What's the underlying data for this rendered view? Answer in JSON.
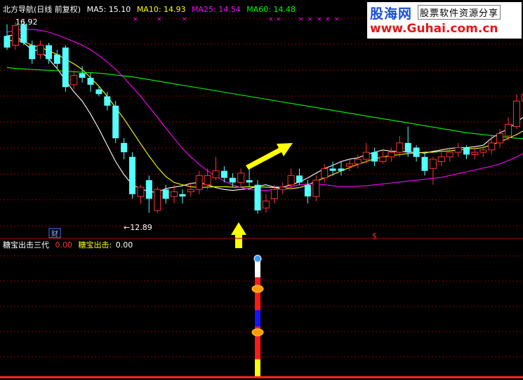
{
  "header": {
    "title": "北方导航(日线 前复权)",
    "ma5": "MA5: 15.10",
    "ma10": "MA10: 14.93",
    "ma25": "MA25: 14.54",
    "ma60": "MA60: 14.48"
  },
  "lower_header": {
    "name": "糖宝出击三代",
    "name_value": "0.00",
    "line_label": "糖宝出击:",
    "line_value": "0.00"
  },
  "markers": {
    "high_label": "16.92",
    "low_label": "←12.89",
    "cai_badge": "财",
    "dollar_mark": "$",
    "x_marks": [
      "×",
      "×",
      "×",
      "×",
      "×",
      "×",
      "×",
      "×",
      "×",
      "×"
    ]
  },
  "watermark": {
    "brand": "股海网",
    "tagline": "股票软件资源分享",
    "url": "www.Guhai.com.cn"
  },
  "colors": {
    "up": "#ff3232",
    "down": "#54ffff",
    "ma5": "#ffffff",
    "ma10": "#ffff00",
    "ma25": "#ff00ff",
    "ma60": "#00ff00",
    "grid": "#8b0000",
    "arrow": "#ffff00"
  },
  "chart_data": {
    "type": "candlestick",
    "ylim": [
      12.5,
      17.2
    ],
    "series": [
      {
        "name": "MA5",
        "values": [
          16.7,
          16.72,
          16.55,
          16.4,
          16.38,
          16.2,
          16.0,
          15.75,
          15.5,
          15.3,
          15.02,
          14.7,
          14.35,
          14.0,
          13.72,
          13.5,
          13.42,
          13.35,
          13.34,
          13.42,
          13.45,
          13.48,
          13.53,
          13.55,
          13.5,
          13.44,
          13.4,
          13.38,
          13.4,
          13.42,
          13.47,
          13.5,
          13.45,
          13.45,
          13.5,
          13.56,
          13.65,
          13.75,
          13.85,
          13.92,
          14.0,
          14.05,
          14.08,
          14.15,
          14.2,
          14.25,
          14.22,
          14.22,
          14.2,
          14.2,
          14.18,
          14.22,
          14.25,
          14.28,
          14.3,
          14.3,
          14.32,
          14.35,
          14.5,
          14.62,
          14.7,
          14.85,
          14.98,
          15.05,
          15.1
        ]
      },
      {
        "name": "MA10",
        "values": [
          16.6,
          16.6,
          16.58,
          16.5,
          16.45,
          16.38,
          16.3,
          16.2,
          16.1,
          15.98,
          15.8,
          15.62,
          15.4,
          15.16,
          14.92,
          14.65,
          14.38,
          14.12,
          13.88,
          13.68,
          13.55,
          13.5,
          13.46,
          13.44,
          13.45,
          13.46,
          13.46,
          13.45,
          13.45,
          13.46,
          13.46,
          13.45,
          13.44,
          13.42,
          13.42,
          13.44,
          13.5,
          13.58,
          13.65,
          13.72,
          13.8,
          13.87,
          13.94,
          14.0,
          14.06,
          14.1,
          14.13,
          14.15,
          14.17,
          14.18,
          14.2,
          14.2,
          14.22,
          14.23,
          14.25,
          14.27,
          14.28,
          14.3,
          14.36,
          14.42,
          14.5,
          14.58,
          14.68,
          14.8,
          14.93
        ]
      },
      {
        "name": "MA25",
        "values": [
          16.78,
          16.82,
          16.84,
          16.84,
          16.82,
          16.78,
          16.72,
          16.65,
          16.58,
          16.5,
          16.4,
          16.28,
          16.14,
          15.98,
          15.8,
          15.6,
          15.4,
          15.18,
          14.95,
          14.72,
          14.5,
          14.28,
          14.1,
          13.94,
          13.8,
          13.68,
          13.58,
          13.5,
          13.44,
          13.4,
          13.38,
          13.38,
          13.4,
          13.42,
          13.46,
          13.5,
          13.52,
          13.52,
          13.5,
          13.48,
          13.46,
          13.46,
          13.47,
          13.48,
          13.5,
          13.52,
          13.54,
          13.56,
          13.58,
          13.6,
          13.62,
          13.64,
          13.66,
          13.7,
          13.74,
          13.78,
          13.82,
          13.86,
          13.9,
          13.95,
          14.02,
          14.1,
          14.2,
          14.35,
          14.54
        ]
      },
      {
        "name": "MA60",
        "values": [
          16.02,
          16.0,
          15.99,
          15.98,
          15.97,
          15.96,
          15.95,
          15.94,
          15.93,
          15.92,
          15.91,
          15.9,
          15.88,
          15.86,
          15.84,
          15.82,
          15.79,
          15.76,
          15.73,
          15.7,
          15.67,
          15.64,
          15.61,
          15.58,
          15.55,
          15.52,
          15.49,
          15.46,
          15.43,
          15.4,
          15.37,
          15.34,
          15.31,
          15.28,
          15.25,
          15.22,
          15.19,
          15.16,
          15.13,
          15.1,
          15.07,
          15.04,
          15.01,
          14.98,
          14.95,
          14.92,
          14.89,
          14.86,
          14.83,
          14.8,
          14.77,
          14.74,
          14.71,
          14.68,
          14.65,
          14.62,
          14.6,
          14.58,
          14.56,
          14.54,
          14.52,
          14.5,
          14.49,
          14.48,
          14.48
        ]
      }
    ],
    "candles": [
      [
        16.7,
        16.45,
        16.95,
        16.4
      ],
      [
        16.5,
        16.92,
        16.99,
        16.4
      ],
      [
        16.95,
        16.55,
        17.05,
        16.5
      ],
      [
        16.5,
        16.2,
        16.6,
        16.1
      ],
      [
        16.3,
        16.5,
        16.6,
        16.2
      ],
      [
        16.5,
        16.2,
        16.55,
        16.1
      ],
      [
        16.3,
        16.1,
        16.4,
        16.0
      ],
      [
        16.45,
        15.6,
        16.5,
        15.5
      ],
      [
        15.65,
        15.85,
        15.95,
        15.55
      ],
      [
        15.9,
        15.8,
        16.05,
        15.7
      ],
      [
        15.8,
        15.65,
        15.9,
        15.5
      ],
      [
        15.55,
        15.45,
        15.6,
        15.4
      ],
      [
        15.4,
        15.2,
        15.5,
        15.1
      ],
      [
        15.2,
        14.5,
        15.3,
        14.4
      ],
      [
        14.4,
        14.2,
        14.5,
        14.05
      ],
      [
        14.1,
        13.3,
        14.2,
        13.2
      ],
      [
        13.25,
        13.45,
        13.5,
        13.1
      ],
      [
        13.6,
        13.2,
        13.7,
        12.9
      ],
      [
        12.95,
        13.4,
        13.45,
        12.89
      ],
      [
        13.4,
        13.2,
        13.5,
        13.1
      ],
      [
        13.25,
        13.35,
        13.5,
        13.1
      ],
      [
        13.3,
        13.25,
        13.4,
        13.1
      ],
      [
        13.35,
        13.4,
        13.55,
        13.25
      ],
      [
        13.4,
        13.7,
        13.8,
        13.3
      ],
      [
        13.5,
        13.7,
        13.85,
        13.4
      ],
      [
        13.65,
        13.8,
        14.1,
        13.6
      ],
      [
        13.8,
        13.65,
        13.9,
        13.55
      ],
      [
        13.65,
        13.55,
        13.75,
        13.45
      ],
      [
        13.55,
        13.75,
        13.85,
        13.45
      ],
      [
        13.6,
        13.55,
        13.9,
        13.45
      ],
      [
        13.5,
        12.95,
        13.6,
        12.88
      ],
      [
        13.0,
        13.15,
        13.3,
        12.9
      ],
      [
        13.2,
        13.4,
        13.5,
        13.1
      ],
      [
        13.4,
        13.45,
        13.55,
        13.3
      ],
      [
        13.5,
        13.7,
        13.85,
        13.4
      ],
      [
        13.7,
        13.55,
        13.85,
        13.5
      ],
      [
        13.5,
        13.25,
        13.6,
        13.1
      ],
      [
        13.25,
        13.6,
        13.7,
        13.15
      ],
      [
        13.65,
        13.85,
        13.95,
        13.55
      ],
      [
        13.85,
        13.8,
        14.0,
        13.7
      ],
      [
        13.85,
        13.8,
        14.0,
        13.7
      ],
      [
        13.9,
        13.95,
        14.05,
        13.8
      ],
      [
        13.95,
        14.05,
        14.15,
        13.85
      ],
      [
        14.05,
        14.2,
        14.4,
        13.95
      ],
      [
        14.2,
        14.0,
        14.3,
        13.9
      ],
      [
        14.0,
        14.1,
        14.25,
        13.95
      ],
      [
        14.1,
        14.2,
        14.3,
        14.0
      ],
      [
        14.2,
        14.4,
        14.55,
        14.1
      ],
      [
        14.4,
        14.2,
        14.75,
        14.1
      ],
      [
        14.3,
        14.1,
        14.35,
        14.0
      ],
      [
        14.1,
        13.8,
        14.2,
        13.7
      ],
      [
        13.85,
        14.05,
        14.1,
        13.5
      ],
      [
        14.0,
        14.1,
        14.2,
        13.9
      ],
      [
        14.1,
        14.2,
        14.3,
        14.0
      ],
      [
        14.2,
        14.3,
        14.4,
        14.1
      ],
      [
        14.3,
        14.15,
        14.35,
        14.05
      ],
      [
        14.15,
        14.2,
        14.3,
        14.05
      ],
      [
        14.2,
        14.25,
        14.35,
        14.1
      ],
      [
        14.25,
        14.4,
        14.55,
        14.15
      ],
      [
        14.4,
        14.6,
        14.7,
        14.3
      ],
      [
        14.55,
        14.8,
        14.95,
        14.45
      ],
      [
        14.75,
        15.3,
        15.45,
        14.7
      ],
      [
        15.3,
        15.45,
        15.65,
        15.1
      ],
      [
        15.0,
        15.1,
        15.25,
        14.85
      ],
      [
        14.9,
        15.25,
        15.35,
        14.8
      ],
      [
        15.0,
        15.55,
        15.6,
        14.85
      ],
      [
        15.55,
        15.3,
        15.65,
        15.2
      ]
    ],
    "indicator": {
      "name": "糖宝出击三代",
      "value": 0.0,
      "line": 0.0,
      "signal_bar_index": 30,
      "segments": [
        "white",
        "red",
        "red",
        "blue",
        "red",
        "red",
        "yellow"
      ]
    },
    "grid": true
  }
}
